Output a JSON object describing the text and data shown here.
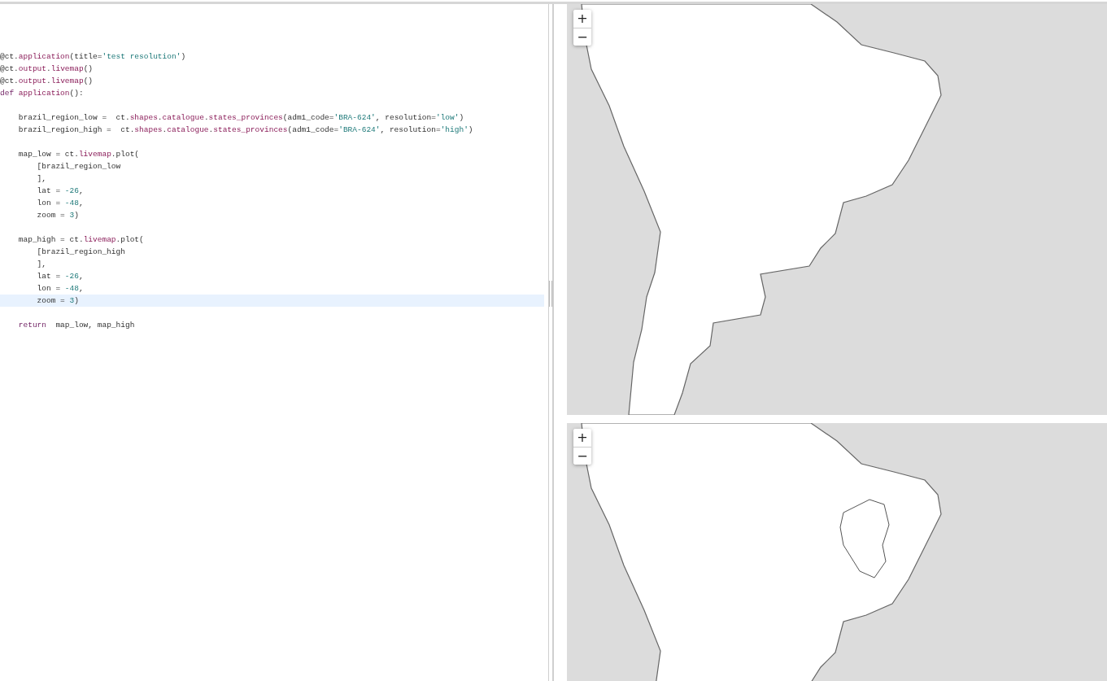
{
  "editor": {
    "blocks": [
      {
        "lines": [
          {
            "current": false,
            "tokens": [
              {
                "kind": "plain",
                "text": "@ct."
              },
              {
                "kind": "attr",
                "text": "application"
              },
              {
                "kind": "plain",
                "text": "(title="
              },
              {
                "kind": "string",
                "text": "'test resolution'"
              },
              {
                "kind": "plain",
                "text": ")"
              }
            ]
          },
          {
            "current": false,
            "tokens": [
              {
                "kind": "plain",
                "text": "@ct."
              },
              {
                "kind": "attr",
                "text": "output"
              },
              {
                "kind": "plain",
                "text": "."
              },
              {
                "kind": "attr",
                "text": "livemap"
              },
              {
                "kind": "plain",
                "text": "()"
              }
            ]
          },
          {
            "current": false,
            "tokens": [
              {
                "kind": "plain",
                "text": "@ct."
              },
              {
                "kind": "attr",
                "text": "output"
              },
              {
                "kind": "plain",
                "text": "."
              },
              {
                "kind": "attr",
                "text": "livemap"
              },
              {
                "kind": "plain",
                "text": "()"
              }
            ]
          },
          {
            "current": false,
            "tokens": [
              {
                "kind": "keyword",
                "text": "def"
              },
              {
                "kind": "attr",
                "text": " application"
              },
              {
                "kind": "plain",
                "text": "():"
              }
            ]
          }
        ]
      },
      {
        "lines": [
          {
            "current": false,
            "tokens": [
              {
                "kind": "plain",
                "text": "    brazil_region_low =  ct."
              },
              {
                "kind": "attr",
                "text": "shapes"
              },
              {
                "kind": "plain",
                "text": "."
              },
              {
                "kind": "attr",
                "text": "catalogue"
              },
              {
                "kind": "plain",
                "text": "."
              },
              {
                "kind": "attr",
                "text": "states_provinces"
              },
              {
                "kind": "plain",
                "text": "(adm1_code="
              },
              {
                "kind": "string",
                "text": "'BRA-624'"
              },
              {
                "kind": "plain",
                "text": ", resolution="
              },
              {
                "kind": "string",
                "text": "'low'"
              },
              {
                "kind": "plain",
                "text": ")"
              }
            ]
          },
          {
            "current": false,
            "tokens": [
              {
                "kind": "plain",
                "text": "    brazil_region_high =  ct."
              },
              {
                "kind": "attr",
                "text": "shapes"
              },
              {
                "kind": "plain",
                "text": "."
              },
              {
                "kind": "attr",
                "text": "catalogue"
              },
              {
                "kind": "plain",
                "text": "."
              },
              {
                "kind": "attr",
                "text": "states_provinces"
              },
              {
                "kind": "plain",
                "text": "(adm1_code="
              },
              {
                "kind": "string",
                "text": "'BRA-624'"
              },
              {
                "kind": "plain",
                "text": ", resolution="
              },
              {
                "kind": "string",
                "text": "'high'"
              },
              {
                "kind": "plain",
                "text": ")"
              }
            ]
          }
        ]
      },
      {
        "lines": [
          {
            "current": false,
            "tokens": [
              {
                "kind": "plain",
                "text": "    map_low = ct."
              },
              {
                "kind": "attr",
                "text": "livemap"
              },
              {
                "kind": "plain",
                "text": ".plot("
              }
            ]
          },
          {
            "current": false,
            "tokens": [
              {
                "kind": "plain",
                "text": "        [brazil_region_low"
              }
            ]
          },
          {
            "current": false,
            "tokens": [
              {
                "kind": "plain",
                "text": "        ],"
              }
            ]
          },
          {
            "current": false,
            "tokens": [
              {
                "kind": "plain",
                "text": "        lat = "
              },
              {
                "kind": "number",
                "text": "-26"
              },
              {
                "kind": "plain",
                "text": ","
              }
            ]
          },
          {
            "current": false,
            "tokens": [
              {
                "kind": "plain",
                "text": "        lon = "
              },
              {
                "kind": "number",
                "text": "-48"
              },
              {
                "kind": "plain",
                "text": ","
              }
            ]
          },
          {
            "current": false,
            "tokens": [
              {
                "kind": "plain",
                "text": "        zoom = "
              },
              {
                "kind": "number",
                "text": "3"
              },
              {
                "kind": "plain",
                "text": ")"
              }
            ]
          }
        ]
      },
      {
        "lines": [
          {
            "current": false,
            "tokens": [
              {
                "kind": "plain",
                "text": "    map_high = ct."
              },
              {
                "kind": "attr",
                "text": "livemap"
              },
              {
                "kind": "plain",
                "text": ".plot("
              }
            ]
          },
          {
            "current": false,
            "tokens": [
              {
                "kind": "plain",
                "text": "        [brazil_region_high"
              }
            ]
          },
          {
            "current": false,
            "tokens": [
              {
                "kind": "plain",
                "text": "        ],"
              }
            ]
          },
          {
            "current": false,
            "tokens": [
              {
                "kind": "plain",
                "text": "        lat = "
              },
              {
                "kind": "number",
                "text": "-26"
              },
              {
                "kind": "plain",
                "text": ","
              }
            ]
          },
          {
            "current": false,
            "tokens": [
              {
                "kind": "plain",
                "text": "        lon = "
              },
              {
                "kind": "number",
                "text": "-48"
              },
              {
                "kind": "plain",
                "text": ","
              }
            ]
          },
          {
            "current": true,
            "tokens": [
              {
                "kind": "plain",
                "text": "        zoom = "
              },
              {
                "kind": "number",
                "text": "3"
              },
              {
                "kind": "plain",
                "text": ")"
              }
            ]
          }
        ]
      },
      {
        "lines": [
          {
            "current": false,
            "tokens": [
              {
                "kind": "keyword",
                "text": "    return"
              },
              {
                "kind": "plain",
                "text": "  map_low, map_high"
              }
            ]
          }
        ]
      }
    ]
  },
  "maps": [
    {
      "zoom_in": "+",
      "zoom_out": "−",
      "region_outline": false
    },
    {
      "zoom_in": "+",
      "zoom_out": "−",
      "region_outline": true
    }
  ]
}
